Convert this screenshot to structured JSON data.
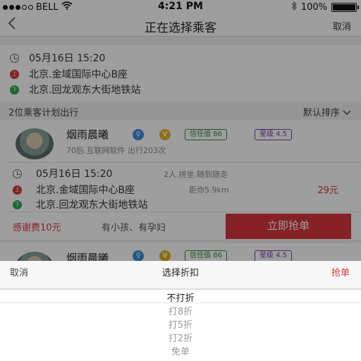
{
  "status_bar": {
    "carrier": "BELL",
    "time": "4:21 PM",
    "battery": "100%"
  },
  "nav": {
    "back_icon": "chevron-left-icon",
    "title": "正在选择乘客",
    "cancel": "取消"
  },
  "trip": {
    "datetime": "05月16日 15:20",
    "from": "北京.金域国际中心B座",
    "to": "北京.回龙观东大街地铁站",
    "from_pin": "上",
    "to_pin": "下"
  },
  "list": {
    "title": "2位乘客计划出行",
    "sort": "默认排序"
  },
  "passenger": {
    "name": "烟雨晨曦",
    "gender_mark": "♀",
    "vip_mark": "V",
    "trust": "信任值 86",
    "star": "星级 4.5",
    "sub": "70后.互联网软件  出行203次",
    "datetime": "05月16日 15:20",
    "note": "2人.拼坐.随到随走",
    "from": "北京.金域国际中心B座",
    "distance": "距你5.9km",
    "price": "29元",
    "to": "北京.回龙观东大街地铁站",
    "thanks": "感谢费10元",
    "extra": "有小孩、有孕妇",
    "grab": "立即抢单"
  },
  "passenger2": {
    "name": "烟雨晨曦",
    "gender_mark": "♀",
    "vip_mark": "V",
    "trust": "信任值 86",
    "star": "星级 4.5"
  },
  "sheet": {
    "cancel": "取消",
    "title": "选择折扣",
    "confirm": "抢单",
    "options": [
      "不打折",
      "打8折",
      "打5折",
      "打2折",
      "免单"
    ],
    "selected_index": 0
  }
}
